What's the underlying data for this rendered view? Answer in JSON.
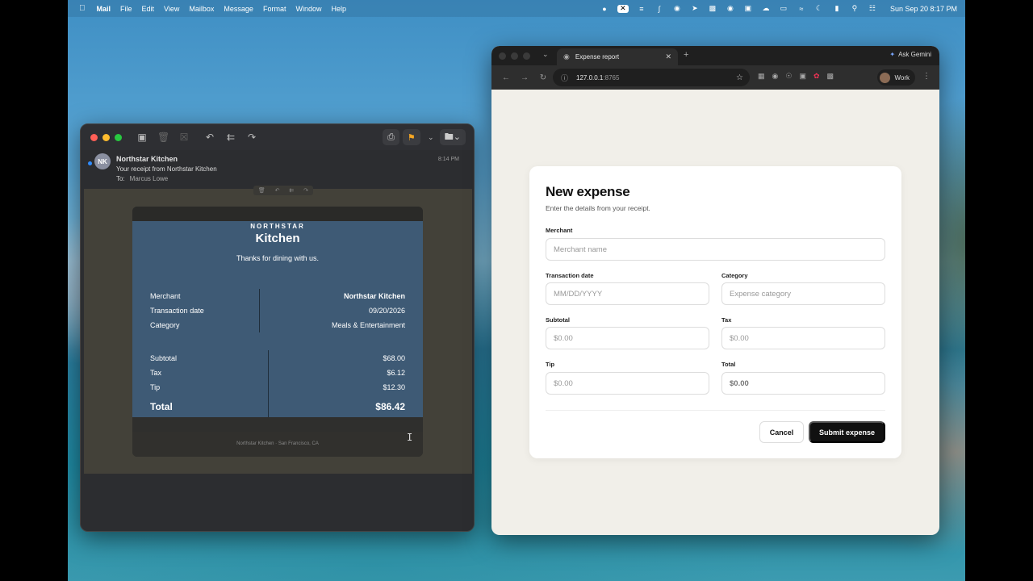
{
  "menubar": {
    "app": "Mail",
    "items": [
      "File",
      "Edit",
      "View",
      "Mailbox",
      "Message",
      "Format",
      "Window",
      "Help"
    ],
    "clock": "Sun Sep 20  8:17 PM"
  },
  "mail": {
    "avatar_initials": "NK",
    "sender": "Northstar Kitchen",
    "subject": "Your receipt from Northstar Kitchen",
    "to_label": "To:",
    "to_value": "Marcus Lowe",
    "time": "8:14 PM",
    "receipt": {
      "brand_small": "NORTHSTAR",
      "brand_big": "Kitchen",
      "thanks": "Thanks for dining with us.",
      "details": [
        {
          "label": "Merchant",
          "value": "Northstar Kitchen"
        },
        {
          "label": "Transaction date",
          "value": "09/20/2026"
        },
        {
          "label": "Category",
          "value": "Meals & Entertainment"
        }
      ],
      "amounts": [
        {
          "label": "Subtotal",
          "value": "$68.00"
        },
        {
          "label": "Tax",
          "value": "$6.12"
        },
        {
          "label": "Tip",
          "value": "$12.30"
        }
      ],
      "total_label": "Total",
      "total_value": "$86.42",
      "footer": "Northstar Kitchen · San Francisco, CA"
    }
  },
  "browser": {
    "tab_title": "Expense report",
    "gemini": "Ask Gemini",
    "url_host": "127.0.0.1",
    "url_port": ":8765",
    "profile": "Work"
  },
  "form": {
    "title": "New expense",
    "subtitle": "Enter the details from your receipt.",
    "merchant": {
      "label": "Merchant",
      "placeholder": "Merchant name"
    },
    "date": {
      "label": "Transaction date",
      "placeholder": "MM/DD/YYYY"
    },
    "category": {
      "label": "Category",
      "placeholder": "Expense category"
    },
    "subtotal": {
      "label": "Subtotal",
      "placeholder": "$0.00"
    },
    "tax": {
      "label": "Tax",
      "placeholder": "$0.00"
    },
    "tip": {
      "label": "Tip",
      "placeholder": "$0.00"
    },
    "total": {
      "label": "Total",
      "placeholder": "$0.00"
    },
    "cancel": "Cancel",
    "submit": "Submit expense"
  }
}
